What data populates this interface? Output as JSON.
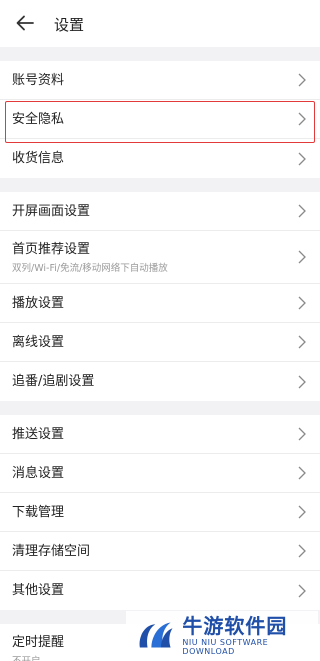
{
  "header": {
    "title": "设置"
  },
  "groups": [
    {
      "items": [
        {
          "label": "账号资料"
        },
        {
          "label": "安全隐私"
        },
        {
          "label": "收货信息"
        }
      ]
    },
    {
      "items": [
        {
          "label": "开屏画面设置"
        },
        {
          "label": "首页推荐设置",
          "sub": "双列/Wi-Fi/免流/移动网络下自动播放"
        },
        {
          "label": "播放设置"
        },
        {
          "label": "离线设置"
        },
        {
          "label": "追番/追剧设置"
        }
      ]
    },
    {
      "items": [
        {
          "label": "推送设置"
        },
        {
          "label": "消息设置"
        },
        {
          "label": "下载管理"
        },
        {
          "label": "清理存储空间"
        },
        {
          "label": "其他设置"
        }
      ]
    },
    {
      "items": [
        {
          "label": "定时提醒",
          "sub": "不开启"
        }
      ]
    }
  ],
  "watermark": {
    "title": "牛游软件园",
    "subtitle": "NIU NIU SOFTWARE DOWNLOAD",
    "color": "#1f4fa8"
  },
  "highlight_color": "#e23a3a"
}
